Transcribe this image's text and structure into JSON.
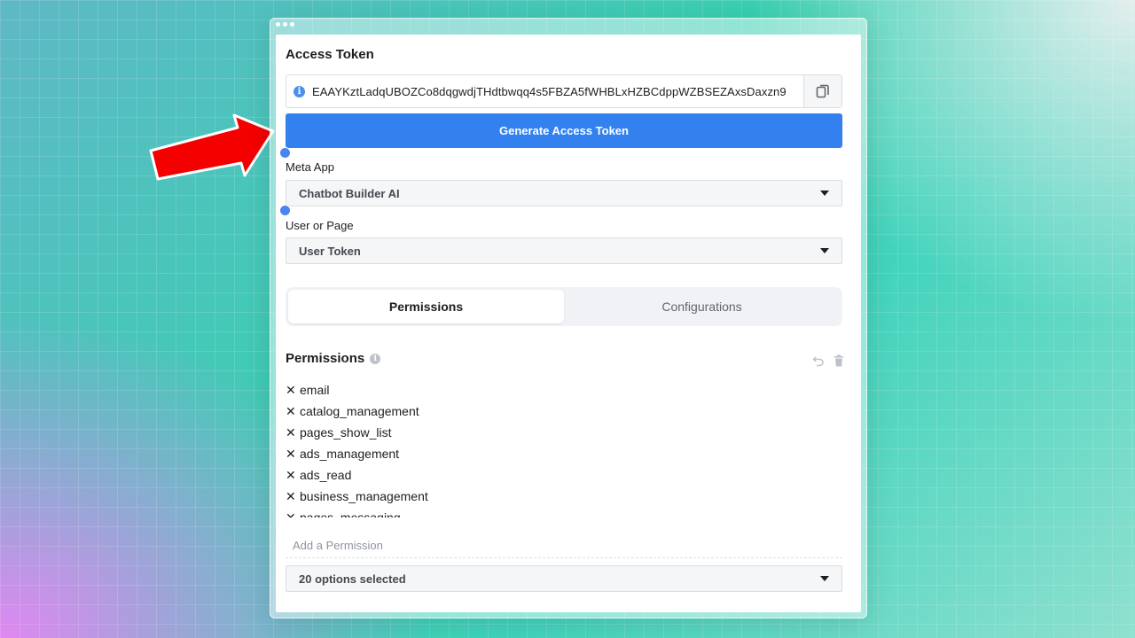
{
  "panel": {
    "title": "Access Token",
    "token_value": "EAAYKztLadqUBOZCo8dqgwdjTHdtbwqq4s5FBZA5fWHBLxHZBCdppWZBSEZAxsDaxzn9",
    "generate_label": "Generate Access Token",
    "meta_app": {
      "label": "Meta App",
      "value": "Chatbot Builder AI"
    },
    "user_or_page": {
      "label": "User or Page",
      "value": "User Token"
    }
  },
  "tabs": [
    {
      "label": "Permissions",
      "active": true
    },
    {
      "label": "Configurations",
      "active": false
    }
  ],
  "permissions": {
    "title": "Permissions",
    "items": [
      "email",
      "catalog_management",
      "pages_show_list",
      "ads_management",
      "ads_read",
      "business_management",
      "pages_messaging"
    ],
    "add_placeholder": "Add a Permission",
    "options_selected": "20 options selected"
  },
  "colors": {
    "primary": "#3381ee",
    "arrow": "#ff0000",
    "handle": "#4a84f0"
  },
  "icons": {
    "info": "info-icon",
    "copy": "copy-icon",
    "undo": "undo-icon",
    "trash": "trash-icon",
    "caret": "caret-down-icon",
    "remove": "x-icon",
    "arrow": "red-arrow-icon"
  }
}
